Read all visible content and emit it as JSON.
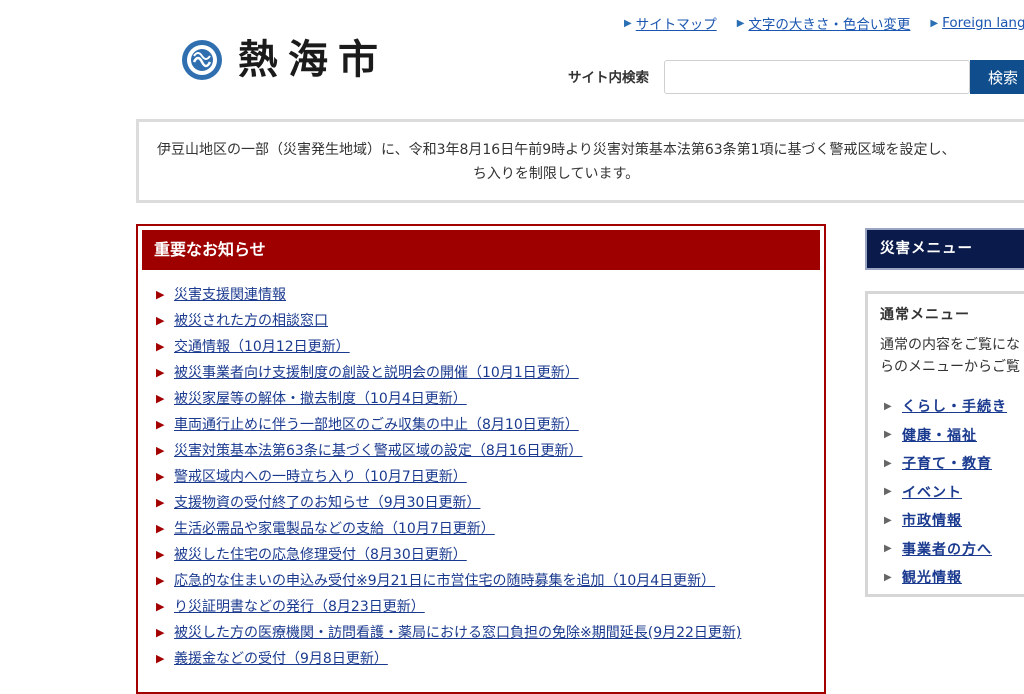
{
  "header": {
    "logo_text": "熱海市",
    "links": [
      {
        "label": "サイトマップ"
      },
      {
        "label": "文字の大きさ・色合い変更"
      },
      {
        "label": "Foreign lang"
      }
    ],
    "search_label": "サイト内検索",
    "search_placeholder": "",
    "search_button": "検索"
  },
  "alert": {
    "line1": "伊豆山地区の一部（災害発生地域）に、令和3年8月16日午前9時より災害対策基本法第63条第1項に基づく警戒区域を設定し、",
    "line2": "ち入りを制限しています。"
  },
  "notice": {
    "title": "重要なお知らせ",
    "items": [
      "災害支援関連情報",
      "被災された方の相談窓口",
      "交通情報（10月12日更新）",
      "被災事業者向け支援制度の創設と説明会の開催（10月1日更新）",
      "被災家屋等の解体・撤去制度（10月4日更新）",
      "車両通行止めに伴う一部地区のごみ収集の中止（8月10日更新）",
      "災害対策基本法第63条に基づく警戒区域の設定（8月16日更新）",
      "警戒区域内への一時立ち入り（10月7日更新）",
      "支援物資の受付終了のお知らせ（9月30日更新）",
      "生活必需品や家電製品などの支給（10月7日更新）",
      "被災した住宅の応急修理受付（8月30日更新）",
      "応急的な住まいの申込み受付※9月21日に市営住宅の随時募集を追加（10月4日更新）",
      "り災証明書などの発行（8月23日更新）",
      "被災した方の医療機関・訪問看護・薬局における窓口負担の免除※期間延長(9月22日更新)",
      "義援金などの受付（9月8日更新）"
    ]
  },
  "sidebar": {
    "disaster_menu": "災害メニュー",
    "normal_menu_title": "通常メニュー",
    "normal_menu_desc1": "通常の内容をご覧にな",
    "normal_menu_desc2": "らのメニューからご覧",
    "menu_items": [
      "くらし・手続き",
      "健康・福祉",
      "子育て・教育",
      "イベント",
      "市政情報",
      "事業者の方へ",
      "観光情報"
    ]
  },
  "colors": {
    "accent_blue": "#0f4d8c",
    "notice_red": "#9e0000",
    "disaster_navy": "#0a1a4a",
    "link_blue": "#1a3a8f"
  }
}
